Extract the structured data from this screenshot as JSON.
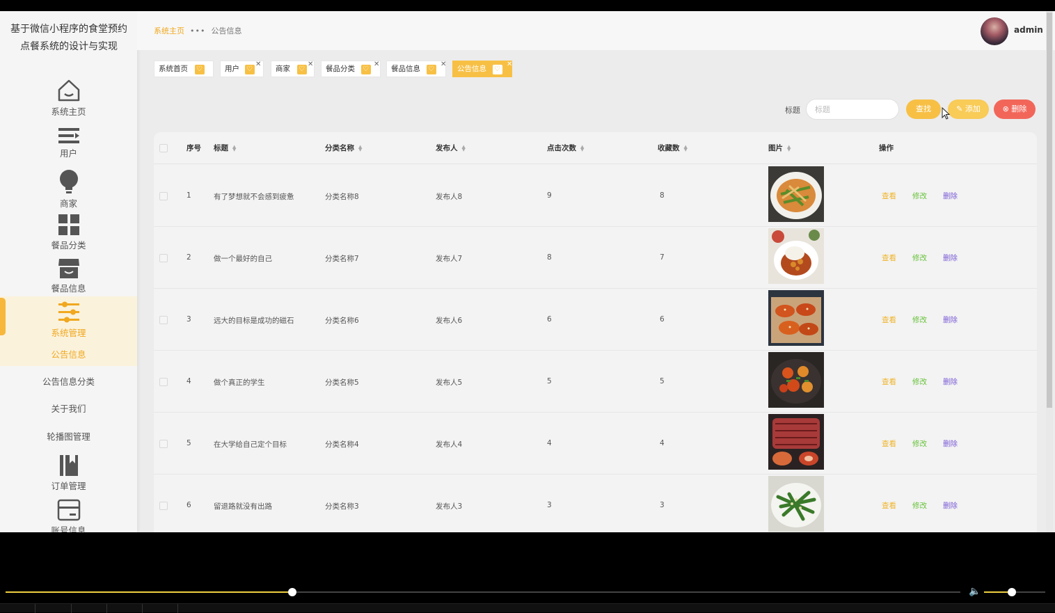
{
  "app": {
    "title": "基于微信小程序的食堂预约点餐系统的设计与实现"
  },
  "sidebar": {
    "items": [
      {
        "label": "系统主页",
        "icon": "home-icon"
      },
      {
        "label": "用户",
        "icon": "list-icon"
      },
      {
        "label": "商家",
        "icon": "lightbulb-icon"
      },
      {
        "label": "餐品分类",
        "icon": "grid-icon"
      },
      {
        "label": "餐品信息",
        "icon": "shop-icon"
      },
      {
        "label": "系统管理",
        "icon": "sliders-icon"
      }
    ],
    "sub_items": [
      {
        "label": "公告信息"
      },
      {
        "label": "公告信息分类"
      },
      {
        "label": "关于我们"
      },
      {
        "label": "轮播图管理"
      }
    ],
    "more_items": [
      {
        "label": "订单管理",
        "icon": "bookmark-icon"
      },
      {
        "label": "账号信息",
        "icon": "card-icon"
      }
    ]
  },
  "header": {
    "breadcrumb_home": "系统主页",
    "breadcrumb_sep": "•••",
    "breadcrumb_current": "公告信息",
    "user": "admin"
  },
  "tags": [
    {
      "label": "系统首页",
      "closable": false
    },
    {
      "label": "用户",
      "closable": true
    },
    {
      "label": "商家",
      "closable": true
    },
    {
      "label": "餐品分类",
      "closable": true
    },
    {
      "label": "餐品信息",
      "closable": true
    },
    {
      "label": "公告信息",
      "closable": true,
      "active": true
    }
  ],
  "search": {
    "label": "标题",
    "placeholder": "标题",
    "find_label": "查找",
    "add_label": "✎ 添加",
    "delete_label": "⊗ 删除"
  },
  "table": {
    "headers": {
      "index": "序号",
      "title": "标题",
      "category": "分类名称",
      "publisher": "发布人",
      "clicks": "点击次数",
      "favorites": "收藏数",
      "image": "图片",
      "actions": "操作"
    },
    "actions": {
      "view": "查看",
      "edit": "修改",
      "delete": "删除"
    },
    "rows": [
      {
        "index": "1",
        "title": "有了梦想就不会感到疲惫",
        "category": "分类名称8",
        "publisher": "发布人8",
        "clicks": "9",
        "favorites": "8",
        "image": "stir-fry-dish"
      },
      {
        "index": "2",
        "title": "做一个最好的自己",
        "category": "分类名称7",
        "publisher": "发布人7",
        "clicks": "8",
        "favorites": "7",
        "image": "rice-curry-dish"
      },
      {
        "index": "3",
        "title": "远大的目标是成功的磁石",
        "category": "分类名称6",
        "publisher": "发布人6",
        "clicks": "6",
        "favorites": "6",
        "image": "grilled-chicken-wings"
      },
      {
        "index": "4",
        "title": "做个真正的学生",
        "category": "分类名称5",
        "publisher": "发布人5",
        "clicks": "5",
        "favorites": "5",
        "image": "spicy-chicken-pan"
      },
      {
        "index": "5",
        "title": "在大学给自己定个目标",
        "category": "分类名称4",
        "publisher": "发布人4",
        "clicks": "4",
        "favorites": "4",
        "image": "grilled-meat"
      },
      {
        "index": "6",
        "title": "留退路就没有出路",
        "category": "分类名称3",
        "publisher": "发布人3",
        "clicks": "3",
        "favorites": "3",
        "image": "green-vegetables"
      }
    ]
  },
  "player": {
    "progress_fraction": 0.3,
    "volume_fraction": 0.45
  },
  "colors": {
    "accent": "#f7c045",
    "danger": "#f2665a",
    "view": "#f0b429",
    "edit": "#67c23a",
    "delete": "#7b5cd6"
  }
}
